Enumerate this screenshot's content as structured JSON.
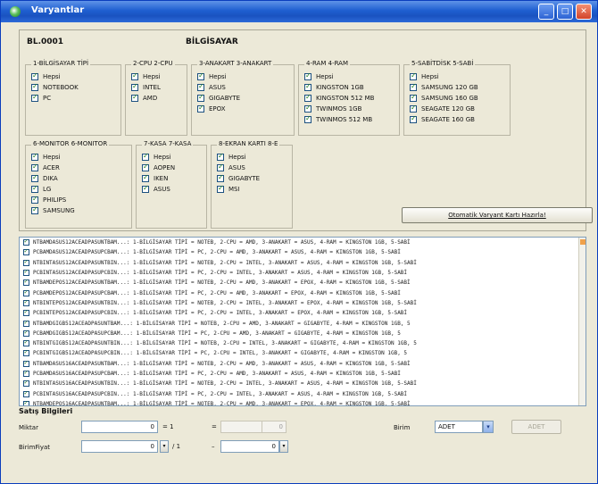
{
  "window": {
    "title": "Varyantlar"
  },
  "header": {
    "code": "BL.0001",
    "name": "BİLGİSAYAR"
  },
  "groups": [
    {
      "title": "1-BİLGİSAYAR TİPİ",
      "options": [
        "Hepsi",
        "NOTEBOOK",
        "PC"
      ]
    },
    {
      "title": "2-CPU 2-CPU",
      "options": [
        "Hepsi",
        "INTEL",
        "AMD"
      ]
    },
    {
      "title": "3-ANAKART 3-ANAKART",
      "options": [
        "Hepsi",
        "ASUS",
        "GIGABYTE",
        "EPOX"
      ]
    },
    {
      "title": "4-RAM 4-RAM",
      "options": [
        "Hepsi",
        "KINGSTON 1GB",
        "KINGSTON 512 MB",
        "TWINMOS 1GB",
        "TWINMOS 512 MB"
      ]
    },
    {
      "title": "5-SABİTDİSK 5-SABİ",
      "options": [
        "Hepsi",
        "SAMSUNG 120 GB",
        "SAMSUNG 160 GB",
        "SEAGATE 120 GB",
        "SEAGATE 160 GB"
      ]
    },
    {
      "title": "6-MONITOR 6-MONITOR",
      "options": [
        "Hepsi",
        "ACER",
        "DIKA",
        "LG",
        "PHILIPS",
        "SAMSUNG"
      ]
    },
    {
      "title": "7-KASA 7-KASA",
      "options": [
        "Hepsi",
        "AOPEN",
        "IKEN",
        "ASUS"
      ]
    },
    {
      "title": "8-EKRAN KARTI 8-E",
      "options": [
        "Hepsi",
        "ASUS",
        "GIGABYTE",
        "MSI"
      ]
    }
  ],
  "stock_button": "Otomatik Varyant Kartı Hazırla!",
  "variants": [
    "NTBAMDASUS12ACEADPASUNTBAM...: 1-BİLGİSAYAR TİPİ = NOTEB, 2-CPU = AMD, 3-ANAKART = ASUS, 4-RAM = KINGSTON 1GB, 5-SABİ",
    "PCBAMDASUS12ACEADPASUPCBAM...: 1-BİLGİSAYAR TİPİ = PC, 2-CPU = AMD, 3-ANAKART = ASUS, 4-RAM = KINGSTON 1GB, 5-SABİ",
    "NTBINTASUS12ACEADPASUNTBIN...: 1-BİLGİSAYAR TİPİ = NOTEB, 2-CPU = INTEL, 3-ANAKART = ASUS, 4-RAM = KINGSTON 1GB, 5-SABİ",
    "PCBINTASUS12ACEADPASUPCBIN...: 1-BİLGİSAYAR TİPİ = PC, 2-CPU = INTEL, 3-ANAKART = ASUS, 4-RAM = KINGSTON 1GB, 5-SABİ",
    "NTBAMDEPOS12ACEADPASUNTBAM...: 1-BİLGİSAYAR TİPİ = NOTEB, 2-CPU = AMD, 3-ANAKART = EPOX, 4-RAM = KINGSTON 1GB, 5-SABİ",
    "PCBAMDEPOS12ACEADPASUPCBAM...: 1-BİLGİSAYAR TİPİ = PC, 2-CPU = AMD, 3-ANAKART = EPOX, 4-RAM = KINGSTON 1GB, 5-SABİ",
    "NTBINTEPOS12ACEADPASUNTBIN...: 1-BİLGİSAYAR TİPİ = NOTEB, 2-CPU = INTEL, 3-ANAKART = EPOX, 4-RAM = KINGSTON 1GB, 5-SABİ",
    "PCBINTEPOS12ACEADPASUPCBIN...: 1-BİLGİSAYAR TİPİ = PC, 2-CPU = INTEL, 3-ANAKART = EPOX, 4-RAM = KINGSTON 1GB, 5-SABİ",
    "NTBAMDGIGB512ACEADPASUNTBAM...: 1-BİLGİSAYAR TİPİ = NOTEB, 2-CPU = AMD, 3-ANAKART = GIGABYTE, 4-RAM = KINGSTON 1GB, 5",
    "PCBAMDGIGB512ACEADPASUPCBAM...: 1-BİLGİSAYAR TİPİ = PC, 2-CPU = AMD, 3-ANAKART = GIGABYTE, 4-RAM = KINGSTON 1GB, 5",
    "NTBINTGIGB512ACEADPASUNTBIN...: 1-BİLGİSAYAR TİPİ = NOTEB, 2-CPU = INTEL, 3-ANAKART = GIGABYTE, 4-RAM = KINGSTON 1GB, 5",
    "PCBINTGIGB512ACEADPASUPCBIN...: 1-BİLGİSAYAR TİPİ = PC, 2-CPU = INTEL, 3-ANAKART = GIGABYTE, 4-RAM = KINGSTON 1GB, 5",
    "NTBAMDASUS16ACEADPASUNTBAM...: 1-BİLGİSAYAR TİPİ = NOTEB, 2-CPU = AMD, 3-ANAKART = ASUS, 4-RAM = KINGSTON 1GB, 5-SABİ",
    "PCBAMDASUS16ACEADPASUPCBAM...: 1-BİLGİSAYAR TİPİ = PC, 2-CPU = AMD, 3-ANAKART = ASUS, 4-RAM = KINGSTON 1GB, 5-SABİ",
    "NTBINTASUS16ACEADPASUNTBIN...: 1-BİLGİSAYAR TİPİ = NOTEB, 2-CPU = INTEL, 3-ANAKART = ASUS, 4-RAM = KINGSTON 1GB, 5-SABİ",
    "PCBINTASUS16ACEADPASUPCBIN...: 1-BİLGİSAYAR TİPİ = PC, 2-CPU = INTEL, 3-ANAKART = ASUS, 4-RAM = KINGSTON 1GB, 5-SABİ",
    "NTBAMDEPOS16ACEADPASUNTBAM...: 1-BİLGİSAYAR TİPİ = NOTEB, 2-CPU = AMD, 3-ANAKART = EPOX, 4-RAM = KINGSTON 1GB, 5-SABİ"
  ],
  "footer": {
    "section_label": "Satış Bilgileri",
    "miktar_label": "Miktar",
    "miktar_value": "0",
    "miktar_suffix": "= 1",
    "eq_sign": "=",
    "birim_label": "BirimFiyat",
    "birim_value": "0",
    "birim_suffix": "/ 1",
    "minus_sign": "–",
    "right_value": "0",
    "birim_field_label": "Birim",
    "birim_field_value": "ADET",
    "top_right_value": "0",
    "disabled_button": "ADET"
  }
}
